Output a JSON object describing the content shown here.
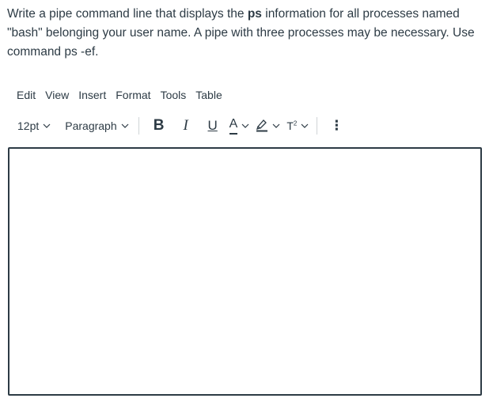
{
  "question": {
    "part1": "Write a pipe command line that displays the ",
    "bold": "ps",
    "part2": " information for all processes named \"bash\" belonging your user name. A pipe with three processes may be necessary. Use command ps -ef."
  },
  "menubar": {
    "items": [
      "Edit",
      "View",
      "Insert",
      "Format",
      "Tools",
      "Table"
    ]
  },
  "toolbar": {
    "font_size": "12pt",
    "block_format": "Paragraph",
    "bold_label": "B",
    "italic_label": "I",
    "underline_label": "U",
    "text_color_label": "A",
    "superscript_label": "T",
    "superscript_sup": "2",
    "more_label": "⋮"
  },
  "editor": {
    "content": ""
  }
}
